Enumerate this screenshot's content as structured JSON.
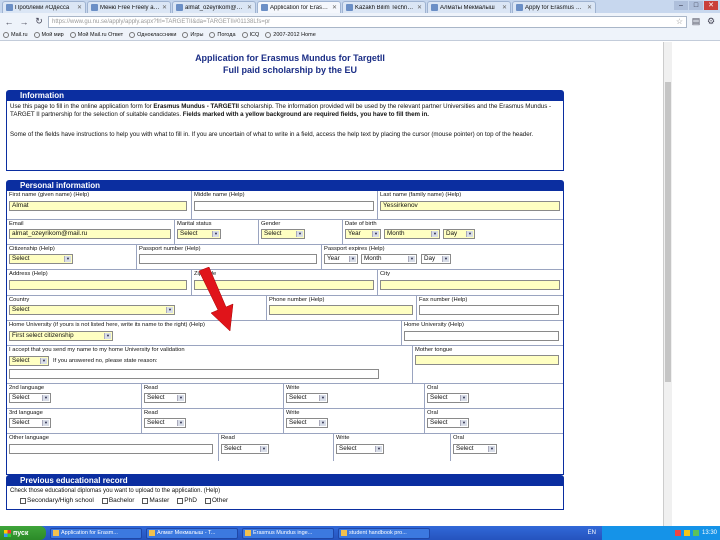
{
  "browser": {
    "tabs": [
      {
        "label": "Проблеми #Одесса"
      },
      {
        "label": "Меню Free Freely adcle"
      },
      {
        "label": "almat_ozeyrikom@mail"
      },
      {
        "label": "Application for Erasmus"
      },
      {
        "label": "Kazakh Bilim Technolo"
      },
      {
        "label": "Алматы Мекмалыш"
      },
      {
        "label": "Apply for Erasmus Mun"
      }
    ],
    "url": "https://www.gu.nu.se/apply/apply.aspx?frl=TARGETII&da=TARGETII#01138Lfs=pr",
    "bookmarks": [
      "Mail.ru",
      "Мой мир",
      "Мой Mail.ru Ответ",
      "Одноклассники",
      "Игры",
      "Погода",
      "ICQ",
      "2007-2012 Home"
    ]
  },
  "page": {
    "title_line1": "Application for Erasmus Mundus for TargetII",
    "title_line2": "Full paid scholarship by the EU",
    "information": {
      "heading": "Information",
      "p1_a": "Use this page to fill in the online application form for ",
      "p1_b": "Erasmus Mundus - TARGETII",
      "p1_c": " scholarship. The information provided will be used by the relevant partner Universities and the Erasmus Mundus - TARGET II partnership for the selection of suitable candidates. ",
      "p1_d": "Fields marked with a yellow background are required fields, you have to fill them in.",
      "p2": "Some of the fields have instructions to help you with what to fill in. If you are uncertain of what to write in a field, access the help text by placing the cursor (mouse pointer) on top of the header."
    },
    "personal": {
      "heading": "Personal information",
      "first_name_label": "First name (given name) (Help)",
      "first_name_value": "Almat",
      "middle_name_label": "Middle name (Help)",
      "last_name_label": "Last name (family name) (Help)",
      "last_name_value": "Yessirkenov",
      "email_label": "Email",
      "email_value": "almat_ozeyrikom@mail.ru",
      "marital_label": "Marital status",
      "marital_value": "Select",
      "gender_label": "Gender",
      "gender_value": "Select",
      "dob_label": "Date of birth",
      "dob_year": "Year",
      "dob_month": "Month",
      "dob_day": "Day",
      "citizenship_label": "Citizenship (Help)",
      "citizenship_value": "Select",
      "passport_number_label": "Passport number (Help)",
      "passport_expires_label": "Passport expires (Help)",
      "passport_year": "Year",
      "passport_month": "Month",
      "passport_day": "Day",
      "address_label": "Address (Help)",
      "zip_label": "Zip code",
      "city_label": "City",
      "country_label": "Country",
      "country_value": "Select",
      "phone_label": "Phone number (Help)",
      "fax_label": "Fax number (Help)",
      "home_uni_note": "Home University (if yours is not listed here, write its name to the right) (Help)",
      "home_uni_value": "First select citizenship",
      "home_uni_label": "Home University (Help)",
      "accept_label": "I accept that you send my name to my home University for validation",
      "accept_value": "Select",
      "accept_note": "If you answered no, please state reason:",
      "mother_tongue_label": "Mother tongue",
      "lang_rows": [
        {
          "language_label": "2nd language",
          "read_label": "Read",
          "write_label": "Write",
          "oral_label": "Oral",
          "language_value": "Select",
          "read_value": "Select",
          "write_value": "Select",
          "oral_value": "Select"
        },
        {
          "language_label": "3rd language",
          "read_label": "Read",
          "write_label": "Write",
          "oral_label": "Oral",
          "language_value": "Select",
          "read_value": "Select",
          "write_value": "Select",
          "oral_value": "Select"
        }
      ],
      "other_language_label": "Other language",
      "other_read_label": "Read",
      "other_write_label": "Write",
      "other_oral_label": "Oral",
      "other_read_value": "Select",
      "other_write_value": "Select",
      "other_oral_value": "Select"
    },
    "education": {
      "heading": "Previous educational record",
      "check_note": "Check those educational diplomas you want to upload to the application. (Help)",
      "options": [
        "Secondary/High school",
        "Bachelor",
        "Master",
        "PhD",
        "Other"
      ]
    }
  },
  "taskbar": {
    "start": "пуск",
    "tasks": [
      "Application for Erasm...",
      "Алмат Мекмалыш - T...",
      "Erasmus Mundus inge...",
      "student handbook pro..."
    ],
    "lang": "EN",
    "clock": "13:30"
  },
  "colors": {
    "section": "#0b2ea0",
    "required": "#ffffc2",
    "title": "#1b2e86",
    "arrow": "#e0141a"
  }
}
